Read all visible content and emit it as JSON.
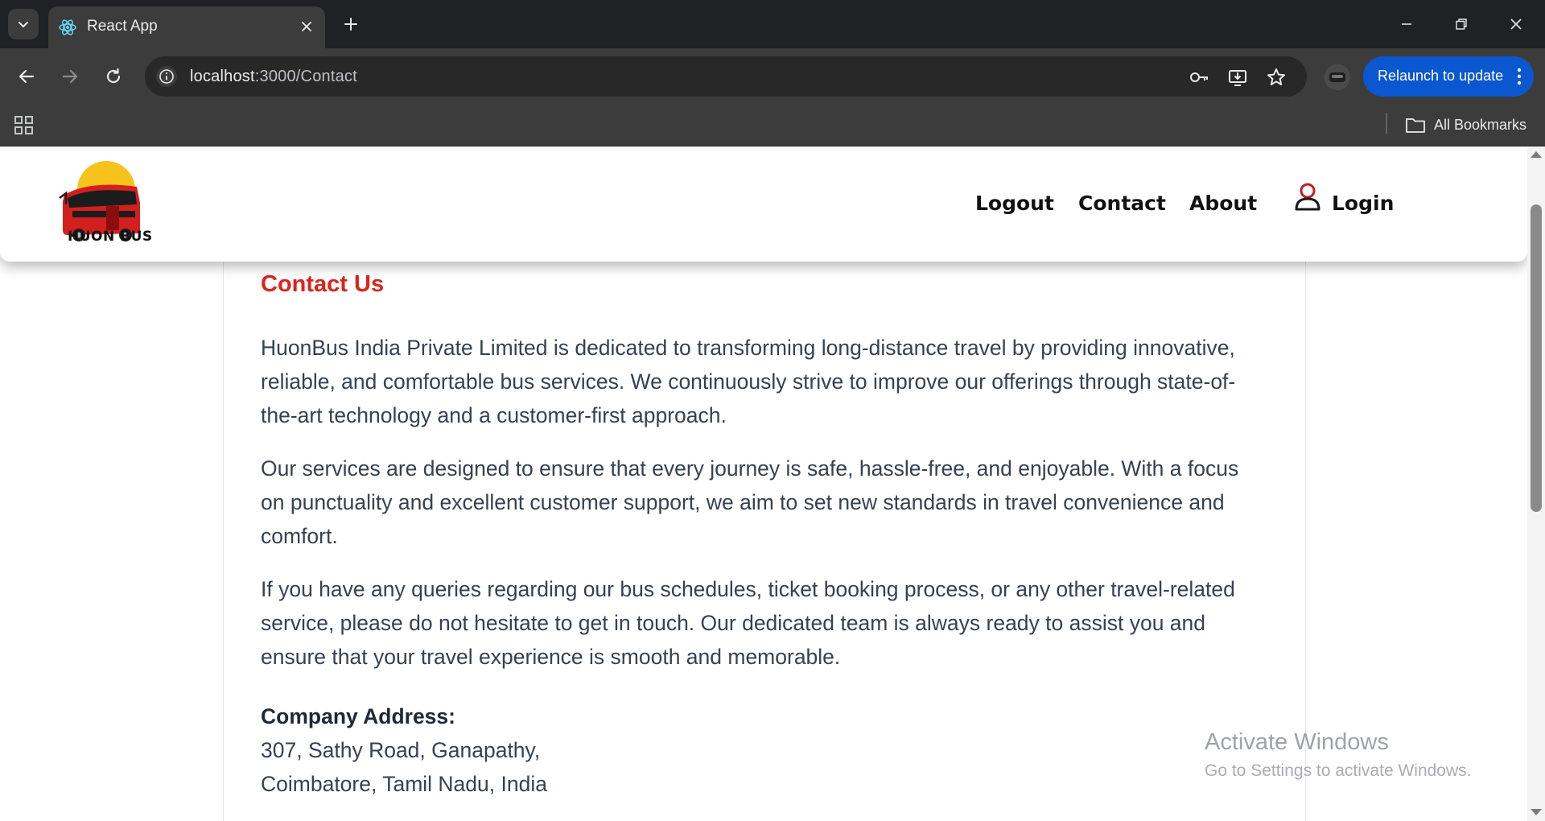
{
  "browser": {
    "tab_title": "React App",
    "url_host": "localhost",
    "url_path": ":3000/Contact",
    "relaunch_label": "Relaunch to update",
    "bookmarks_label": "All Bookmarks"
  },
  "header": {
    "logo_text": "HUON BUS",
    "nav": {
      "logout": "Logout",
      "contact": "Contact",
      "about": "About",
      "login": "Login"
    }
  },
  "main": {
    "title": "Contact Us",
    "paragraphs": [
      "HuonBus India Private Limited is dedicated to transforming long-distance travel by providing innovative, reliable, and comfortable bus services. We continuously strive to improve our offerings through state-of-the-art technology and a customer-first approach.",
      "Our services are designed to ensure that every journey is safe, hassle-free, and enjoyable. With a focus on punctuality and excellent customer support, we aim to set new standards in travel convenience and comfort.",
      "If you have any queries regarding our bus schedules, ticket booking process, or any other travel-related service, please do not hesitate to get in touch. Our dedicated team is always ready to assist you and ensure that your travel experience is smooth and memorable."
    ],
    "address_label": "Company Address:",
    "address_lines": [
      "307, Sathy Road, Ganapathy,",
      "Coimbatore, Tamil Nadu, India"
    ]
  },
  "watermark": {
    "title": "Activate Windows",
    "subtitle": "Go to Settings to activate Windows."
  },
  "colors": {
    "accent": "#d9251d",
    "relaunch": "#0b57d0",
    "chrome_dark": "#202124",
    "chrome_mid": "#3c3c3c"
  }
}
